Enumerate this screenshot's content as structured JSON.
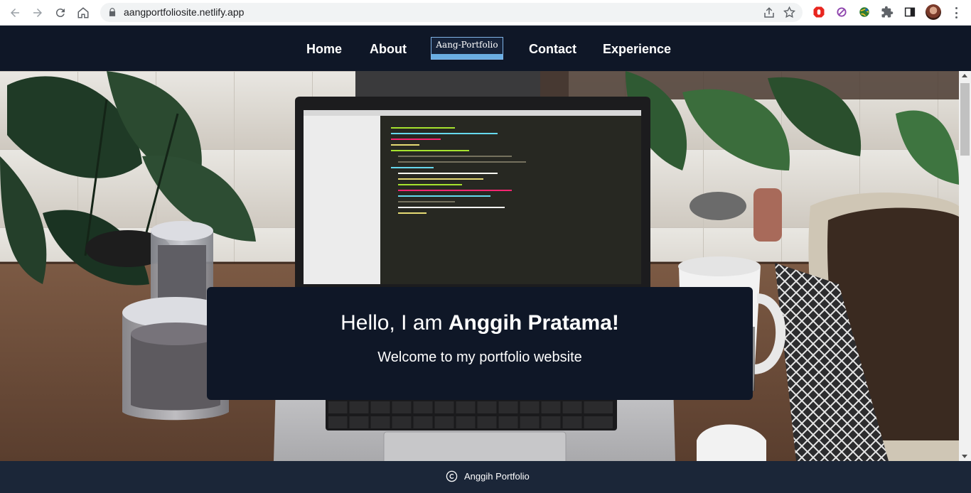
{
  "browser": {
    "url": "aangportfoliosite.netlify.app",
    "icons": [
      "back-icon",
      "forward-icon",
      "reload-icon",
      "home-icon",
      "lock-icon",
      "share-icon",
      "star-icon",
      "adblock-extension-icon",
      "blocker-extension-icon",
      "globe-extension-icon",
      "puzzle-extensions-icon",
      "side-panel-icon",
      "profile-avatar",
      "menu-dots-icon"
    ]
  },
  "nav": {
    "links": [
      {
        "label": "Home"
      },
      {
        "label": "About"
      },
      {
        "label": "Contact"
      },
      {
        "label": "Experience"
      }
    ],
    "brand": "Aang-Portfolio"
  },
  "hero": {
    "greeting": "Hello, I am ",
    "name": "Anggih Pratama!",
    "subtitle": "Welcome to my portfolio website"
  },
  "footer": {
    "text": "Anggih Portfolio"
  },
  "colors": {
    "nav_bg": "#0f1727",
    "card_bg": "#0f1727",
    "footer_bg": "#1b2638",
    "brand_accent": "#6aaee3",
    "text": "#ffffff"
  }
}
